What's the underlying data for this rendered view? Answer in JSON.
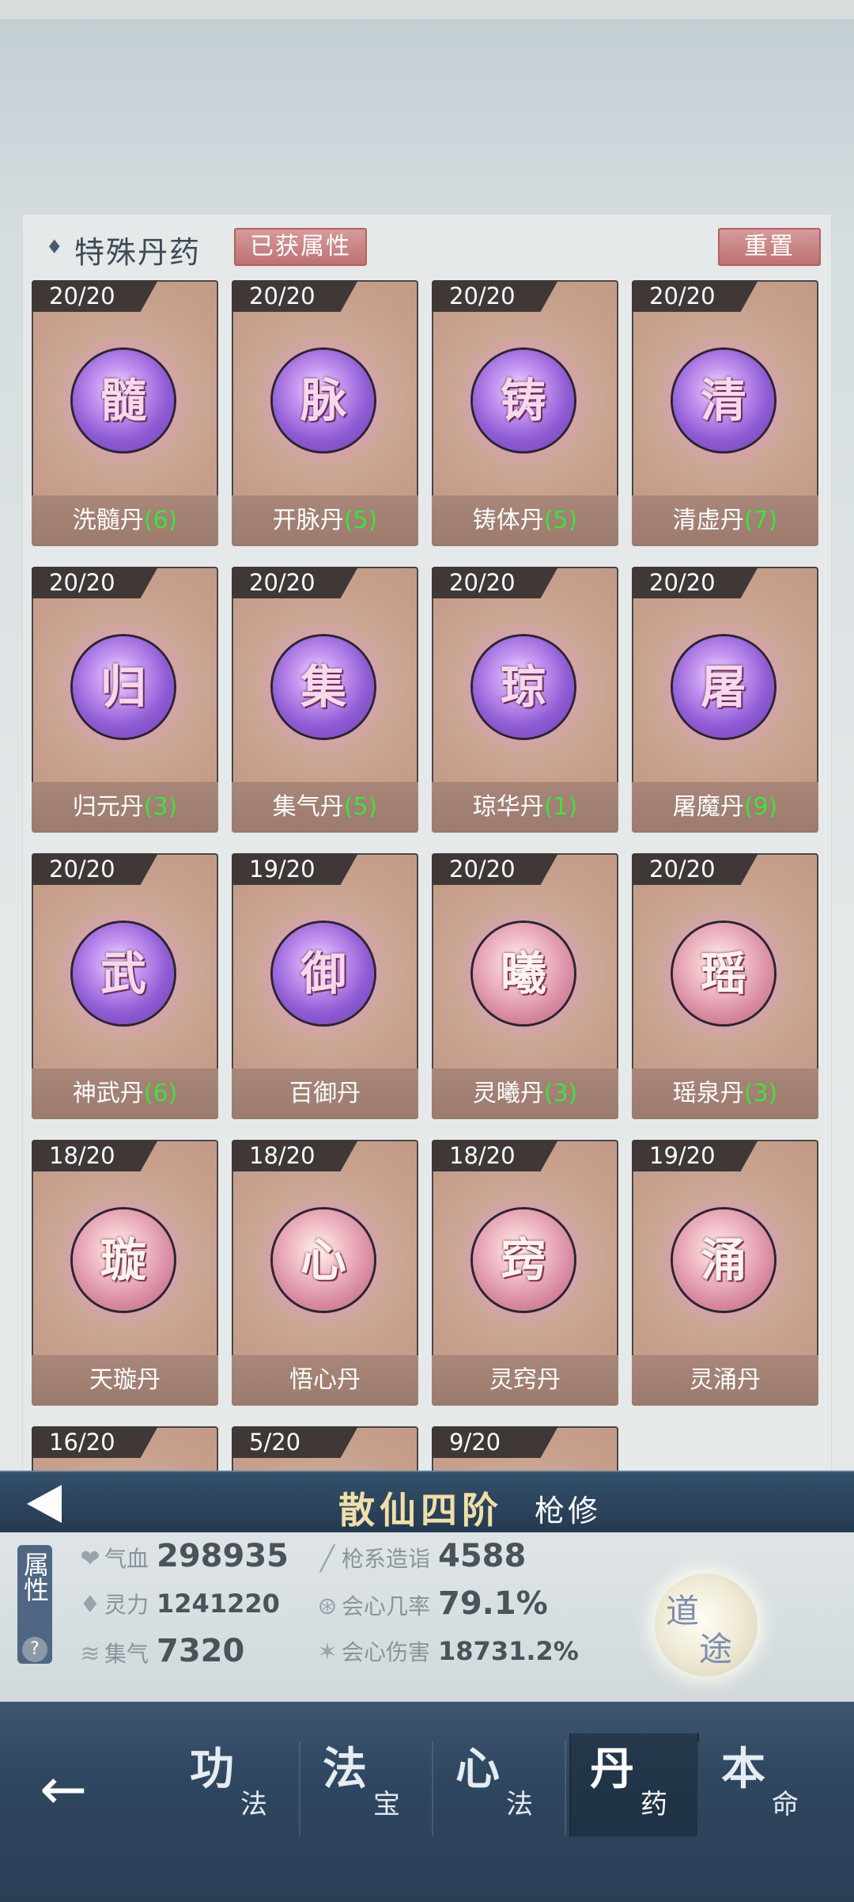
{
  "section": {
    "title": "特殊丹药",
    "obtained_label": "已获属性",
    "reset_label": "重置"
  },
  "pills": [
    {
      "count": "20/20",
      "char": "髓",
      "name": "洗髓丹",
      "level": "(6)",
      "color": "purple"
    },
    {
      "count": "20/20",
      "char": "脉",
      "name": "开脉丹",
      "level": "(5)",
      "color": "purple"
    },
    {
      "count": "20/20",
      "char": "铸",
      "name": "铸体丹",
      "level": "(5)",
      "color": "purple"
    },
    {
      "count": "20/20",
      "char": "清",
      "name": "清虚丹",
      "level": "(7)",
      "color": "purple"
    },
    {
      "count": "20/20",
      "char": "归",
      "name": "归元丹",
      "level": "(3)",
      "color": "purple"
    },
    {
      "count": "20/20",
      "char": "集",
      "name": "集气丹",
      "level": "(5)",
      "color": "purple"
    },
    {
      "count": "20/20",
      "char": "琼",
      "name": "琼华丹",
      "level": "(1)",
      "color": "purple"
    },
    {
      "count": "20/20",
      "char": "屠",
      "name": "屠魔丹",
      "level": "(9)",
      "color": "purple"
    },
    {
      "count": "20/20",
      "char": "武",
      "name": "神武丹",
      "level": "(6)",
      "color": "purple"
    },
    {
      "count": "19/20",
      "char": "御",
      "name": "百御丹",
      "level": "",
      "color": "purple"
    },
    {
      "count": "20/20",
      "char": "曦",
      "name": "灵曦丹",
      "level": "(3)",
      "color": "pink"
    },
    {
      "count": "20/20",
      "char": "瑶",
      "name": "瑶泉丹",
      "level": "(3)",
      "color": "pink"
    },
    {
      "count": "18/20",
      "char": "璇",
      "name": "天璇丹",
      "level": "",
      "color": "pink"
    },
    {
      "count": "18/20",
      "char": "心",
      "name": "悟心丹",
      "level": "",
      "color": "pink"
    },
    {
      "count": "18/20",
      "char": "窍",
      "name": "灵窍丹",
      "level": "",
      "color": "pink"
    },
    {
      "count": "19/20",
      "char": "涌",
      "name": "灵涌丹",
      "level": "",
      "color": "pink"
    },
    {
      "count": "16/20",
      "char": "",
      "name": "",
      "level": "",
      "color": "pink"
    },
    {
      "count": "5/20",
      "char": "",
      "name": "",
      "level": "",
      "color": "pink"
    },
    {
      "count": "9/20",
      "char": "",
      "name": "",
      "level": "",
      "color": "pink"
    }
  ],
  "character": {
    "realm": "散仙四阶",
    "class": "枪修"
  },
  "stats": {
    "attr_label": "属性",
    "help": "?",
    "hp_label": "气血",
    "hp_value": "298935",
    "mp_label": "灵力",
    "mp_value": "1241220",
    "qi_label": "集气",
    "qi_value": "7320",
    "spear_label": "枪系造诣",
    "spear_value": "4588",
    "crit_rate_label": "会心几率",
    "crit_rate_value": "79.1%",
    "crit_dmg_label": "会心伤害",
    "crit_dmg_value": "18731.2%"
  },
  "dao": {
    "char1": "道",
    "char2": "途"
  },
  "nav": {
    "back": "←",
    "items": [
      {
        "big": "功",
        "small": "法"
      },
      {
        "big": "法",
        "small": "宝"
      },
      {
        "big": "心",
        "small": "法"
      },
      {
        "big": "丹",
        "small": "药"
      },
      {
        "big": "本",
        "small": "命"
      }
    ],
    "active_index": 3
  },
  "colors": {
    "level_green": "#3ee23e",
    "purple_orb": "#8f5cd4",
    "pink_orb": "#d88aa0",
    "name_bar": "#a88679"
  }
}
